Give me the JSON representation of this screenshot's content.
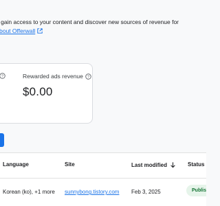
{
  "intro": {
    "line1": "o gain access to your content and discover new sources of revenue for",
    "learn_link": "bout Offerwall"
  },
  "metric_card": {
    "label": "Rewarded ads revenue",
    "value": "$0.00"
  },
  "table": {
    "headers": {
      "language": "Language",
      "site": "Site",
      "last_modified": "Last modified",
      "status": "Status"
    },
    "rows": [
      {
        "language": "Korean (ko), +1 more",
        "site": "sunnybong.tistory.com",
        "last_modified": "Feb 3, 2025",
        "status": "Publish"
      }
    ]
  },
  "colors": {
    "accent": "#1a73e8",
    "status_bg": "#e6f4ea",
    "status_text": "#137333"
  }
}
